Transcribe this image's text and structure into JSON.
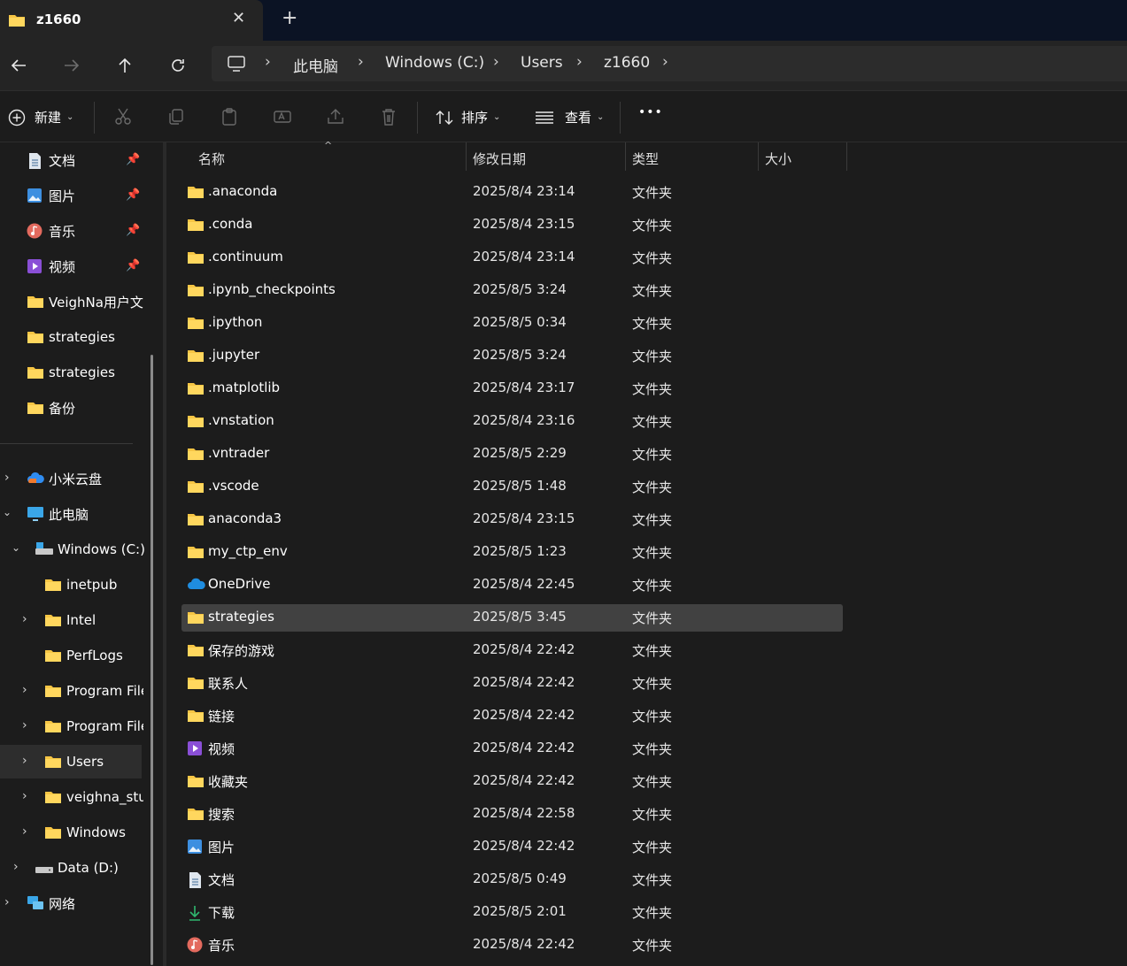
{
  "window": {
    "tab_title": "z1660",
    "tab_close": "✕",
    "new_tab": "+"
  },
  "address": {
    "crumbs": [
      "此电脑",
      "Windows (C:)",
      "Users",
      "z1660"
    ]
  },
  "toolbar": {
    "new_label": "新建",
    "sort_label": "排序",
    "view_label": "查看",
    "more_label": "•••"
  },
  "sidebar": {
    "pinned": [
      {
        "label": "文档",
        "icon": "document-icon"
      },
      {
        "label": "图片",
        "icon": "pictures-icon"
      },
      {
        "label": "音乐",
        "icon": "music-icon"
      },
      {
        "label": "视频",
        "icon": "video-icon"
      }
    ],
    "folders": [
      "VeighNa用户文",
      "strategies",
      "strategies",
      "备份"
    ],
    "tree": [
      {
        "label": "小米云盘",
        "icon": "cloud-icon"
      },
      {
        "label": "此电脑",
        "icon": "computer-icon"
      },
      {
        "label": "Windows (C:)",
        "icon": "drive-icon"
      },
      {
        "label": "inetpub"
      },
      {
        "label": "Intel"
      },
      {
        "label": "PerfLogs"
      },
      {
        "label": "Program File"
      },
      {
        "label": "Program File"
      },
      {
        "label": "Users"
      },
      {
        "label": "veighna_stu"
      },
      {
        "label": "Windows"
      },
      {
        "label": "Data (D:)",
        "icon": "drive-icon"
      },
      {
        "label": "网络",
        "icon": "network-icon"
      }
    ]
  },
  "columns": {
    "name": "名称",
    "modified": "修改日期",
    "type": "类型",
    "size": "大小"
  },
  "files": [
    {
      "name": ".anaconda",
      "modified": "2025/8/4 23:14",
      "type": "文件夹",
      "icon": "folder-icon"
    },
    {
      "name": ".conda",
      "modified": "2025/8/4 23:15",
      "type": "文件夹",
      "icon": "folder-icon"
    },
    {
      "name": ".continuum",
      "modified": "2025/8/4 23:14",
      "type": "文件夹",
      "icon": "folder-icon"
    },
    {
      "name": ".ipynb_checkpoints",
      "modified": "2025/8/5 3:24",
      "type": "文件夹",
      "icon": "folder-icon"
    },
    {
      "name": ".ipython",
      "modified": "2025/8/5 0:34",
      "type": "文件夹",
      "icon": "folder-icon"
    },
    {
      "name": ".jupyter",
      "modified": "2025/8/5 3:24",
      "type": "文件夹",
      "icon": "folder-icon"
    },
    {
      "name": ".matplotlib",
      "modified": "2025/8/4 23:17",
      "type": "文件夹",
      "icon": "folder-icon"
    },
    {
      "name": ".vnstation",
      "modified": "2025/8/4 23:16",
      "type": "文件夹",
      "icon": "folder-icon"
    },
    {
      "name": ".vntrader",
      "modified": "2025/8/5 2:29",
      "type": "文件夹",
      "icon": "folder-icon"
    },
    {
      "name": ".vscode",
      "modified": "2025/8/5 1:48",
      "type": "文件夹",
      "icon": "folder-icon"
    },
    {
      "name": "anaconda3",
      "modified": "2025/8/4 23:15",
      "type": "文件夹",
      "icon": "folder-icon"
    },
    {
      "name": "my_ctp_env",
      "modified": "2025/8/5 1:23",
      "type": "文件夹",
      "icon": "folder-icon"
    },
    {
      "name": "OneDrive",
      "modified": "2025/8/4 22:45",
      "type": "文件夹",
      "icon": "onedrive-icon"
    },
    {
      "name": "strategies",
      "modified": "2025/8/5 3:45",
      "type": "文件夹",
      "icon": "folder-icon",
      "selected": true
    },
    {
      "name": "保存的游戏",
      "modified": "2025/8/4 22:42",
      "type": "文件夹",
      "icon": "folder-icon"
    },
    {
      "name": "联系人",
      "modified": "2025/8/4 22:42",
      "type": "文件夹",
      "icon": "folder-icon"
    },
    {
      "name": "链接",
      "modified": "2025/8/4 22:42",
      "type": "文件夹",
      "icon": "folder-icon"
    },
    {
      "name": "视频",
      "modified": "2025/8/4 22:42",
      "type": "文件夹",
      "icon": "video-icon"
    },
    {
      "name": "收藏夹",
      "modified": "2025/8/4 22:42",
      "type": "文件夹",
      "icon": "folder-icon"
    },
    {
      "name": "搜索",
      "modified": "2025/8/4 22:58",
      "type": "文件夹",
      "icon": "folder-icon"
    },
    {
      "name": "图片",
      "modified": "2025/8/4 22:42",
      "type": "文件夹",
      "icon": "pictures-icon"
    },
    {
      "name": "文档",
      "modified": "2025/8/5 0:49",
      "type": "文件夹",
      "icon": "document-icon"
    },
    {
      "name": "下载",
      "modified": "2025/8/5 2:01",
      "type": "文件夹",
      "icon": "download-icon"
    },
    {
      "name": "音乐",
      "modified": "2025/8/4 22:42",
      "type": "文件夹",
      "icon": "music-icon"
    }
  ],
  "colors": {
    "folder": "#f6c544",
    "selection": "#414141",
    "titlebar": "#0b1324"
  }
}
